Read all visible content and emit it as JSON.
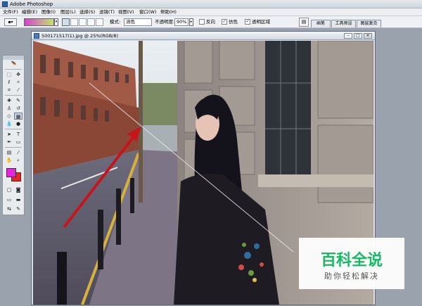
{
  "app": {
    "title": "Adobe Photoshop"
  },
  "menu": [
    "文件(F)",
    "编辑(E)",
    "图像(I)",
    "图层(L)",
    "选择(S)",
    "滤镜(T)",
    "视图(V)",
    "窗口(W)",
    "帮助(H)"
  ],
  "options": {
    "mode_label": "模式:",
    "mode_value": "溶色",
    "opacity_label": "不透明度:",
    "opacity_value": "90%",
    "reverse_label": "反向",
    "dither_label": "仿色",
    "transparency_label": "透明区域",
    "reverse_checked": false,
    "dither_checked": true,
    "transparency_checked": true,
    "gradient_colors": [
      "#e03cd7",
      "#bfe76a"
    ]
  },
  "panel_tabs": [
    "画笔",
    "工具预设",
    "图层复合"
  ],
  "document": {
    "title": "500171517(1).jpg @ 25%(RGB/8)"
  },
  "toolbox": {
    "foreground_color": "#e627d8",
    "background_color": "#e62626"
  },
  "watermark": {
    "main": "百科全说",
    "sub": "助你轻松解决"
  }
}
